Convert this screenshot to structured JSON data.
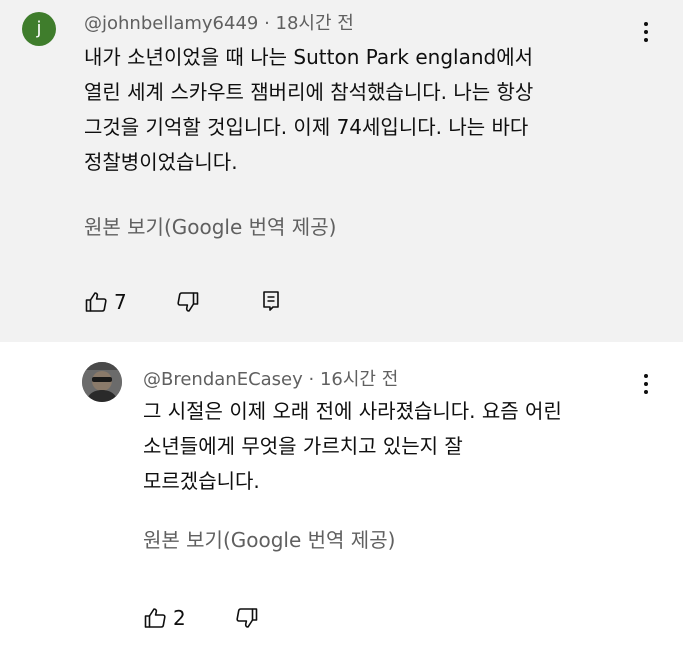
{
  "comment": {
    "avatar_letter": "j",
    "author": "@johnbellamy6449",
    "separator": " · ",
    "time": "18시간 전",
    "lines": [
      "내가 소년이었을 때 나는 Sutton Park england에서",
      "열린 세계 스카우트 잼버리에 참석했습니다. 나는 항상",
      "그것을 기억할 것입니다. 이제 74세입니다. 나는 바다",
      "정찰병이었습니다."
    ],
    "translation_note": "원본 보기(Google 번역 제공)",
    "like_count": "7"
  },
  "reply": {
    "author": "@BrendanECasey",
    "separator": " · ",
    "time": "16시간 전",
    "lines": [
      "그 시절은 이제 오래 전에 사라졌습니다. 요즘 어린",
      "소년들에게 무엇을 가르치고 있는지 잘",
      "모르겠습니다."
    ],
    "translation_note": "원본 보기(Google 번역 제공)",
    "like_count": "2"
  },
  "icons": {
    "like": "thumbs-up-icon",
    "dislike": "thumbs-down-icon",
    "reply": "reply-icon",
    "more": "more-vertical-icon"
  },
  "colors": {
    "avatar_green": "#3f7d2c",
    "highlight_bg": "#f2f2f2",
    "secondary_text": "#606060"
  }
}
